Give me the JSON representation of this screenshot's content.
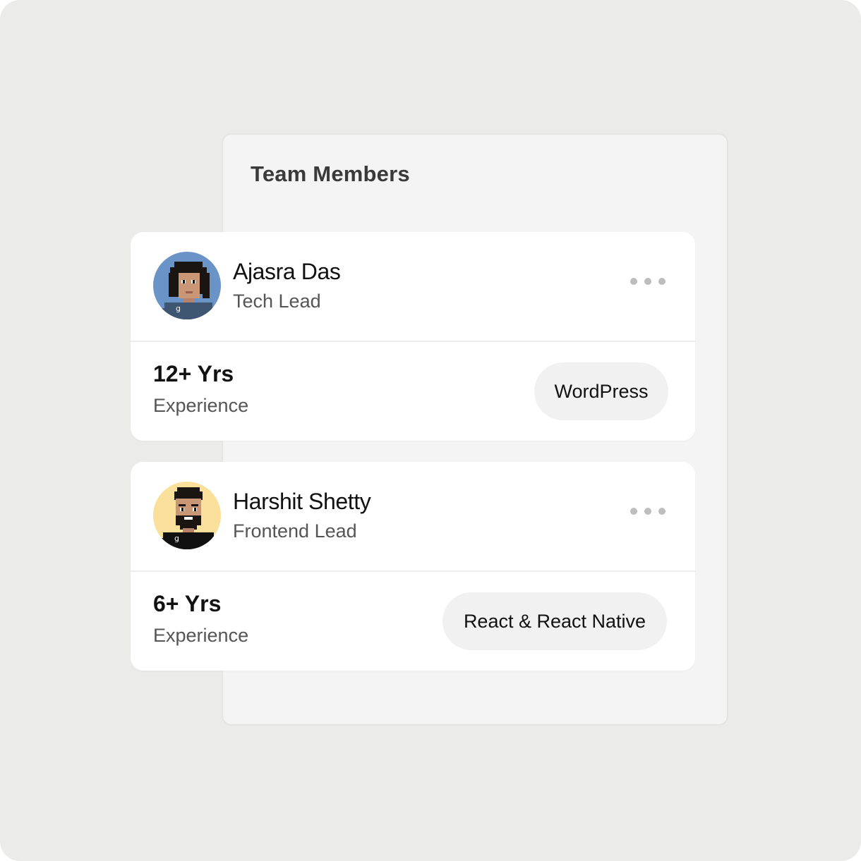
{
  "panel": {
    "title": "Team Members"
  },
  "members": [
    {
      "name": "Ajasra Das",
      "role": "Tech Lead",
      "experience_value": "12+ Yrs",
      "experience_label": "Experience",
      "skill": "WordPress",
      "avatar_bg": "#6a94c8",
      "more_icon": "more-horizontal-icon"
    },
    {
      "name": "Harshit Shetty",
      "role": "Frontend Lead",
      "experience_value": "6+ Yrs",
      "experience_label": "Experience",
      "skill": "React & React Native",
      "avatar_bg": "#fbe09c",
      "more_icon": "more-horizontal-icon"
    }
  ]
}
